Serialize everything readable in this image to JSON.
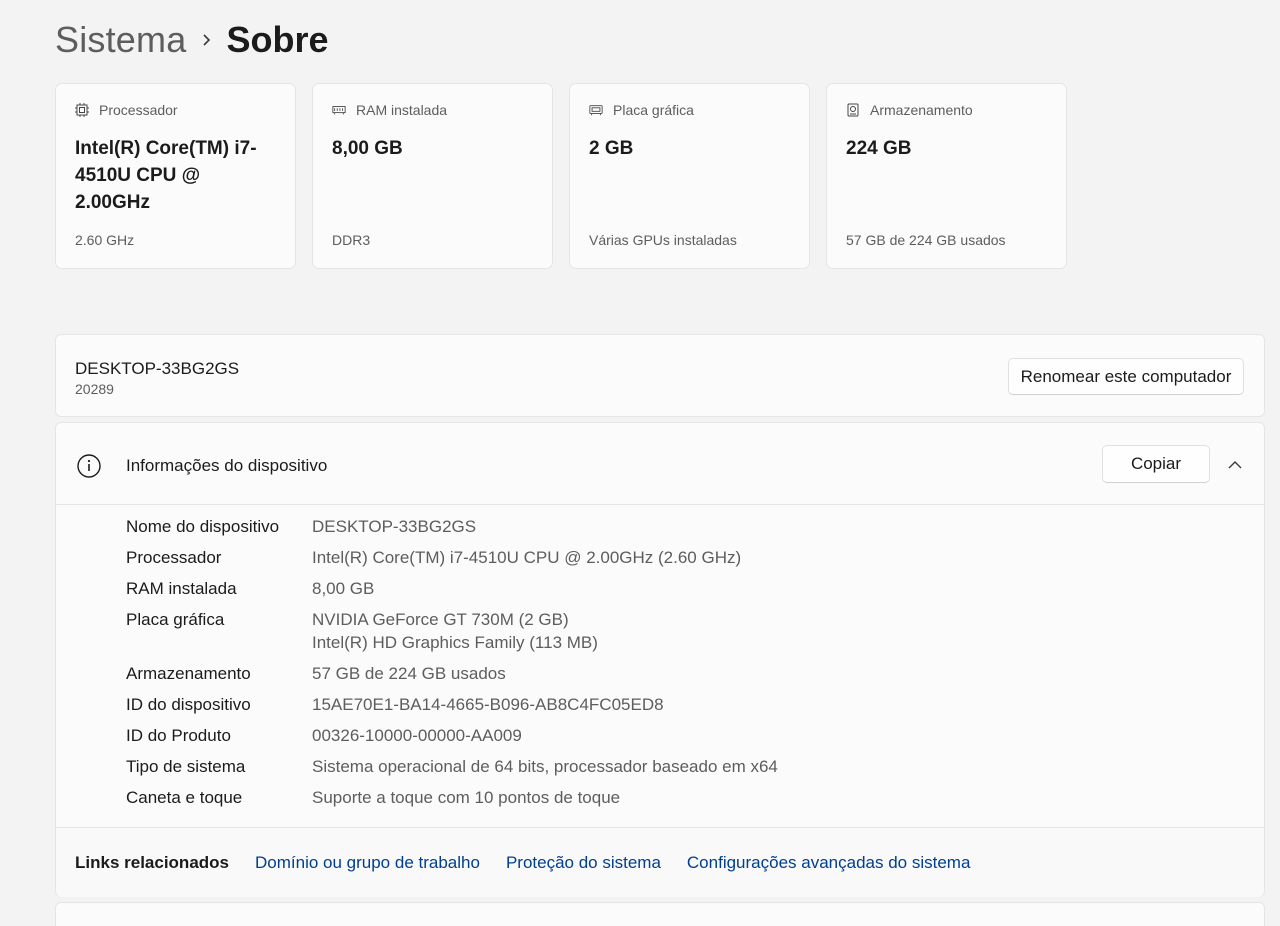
{
  "breadcrumb": {
    "parent": "Sistema",
    "current": "Sobre"
  },
  "cards": [
    {
      "label": "Processador",
      "value": "Intel(R) Core(TM) i7-4510U CPU @ 2.00GHz",
      "sub": "2.60 GHz",
      "icon": "processor-icon"
    },
    {
      "label": "RAM instalada",
      "value": "8,00 GB",
      "sub": "DDR3",
      "icon": "ram-icon"
    },
    {
      "label": "Placa gráfica",
      "value": "2 GB",
      "sub": "Várias GPUs instaladas",
      "icon": "gpu-icon"
    },
    {
      "label": "Armazenamento",
      "value": "224 GB",
      "sub": "57 GB de 224 GB usados",
      "icon": "storage-icon"
    }
  ],
  "device": {
    "name": "DESKTOP-33BG2GS",
    "number": "20289",
    "rename_label": "Renomear este computador"
  },
  "info": {
    "title": "Informações do dispositivo",
    "copy_label": "Copiar",
    "rows": [
      {
        "label": "Nome do dispositivo",
        "value": "DESKTOP-33BG2GS"
      },
      {
        "label": "Processador",
        "value": "Intel(R) Core(TM) i7-4510U CPU @ 2.00GHz (2.60 GHz)"
      },
      {
        "label": "RAM instalada",
        "value": "8,00 GB"
      },
      {
        "label": "Placa gráfica",
        "value": "NVIDIA GeForce GT 730M (2 GB)",
        "value2": "Intel(R) HD Graphics Family (113 MB)"
      },
      {
        "label": "Armazenamento",
        "value": "57 GB de 224 GB usados"
      },
      {
        "label": "ID do dispositivo",
        "value": "15AE70E1-BA14-4665-B096-AB8C4FC05ED8"
      },
      {
        "label": "ID do Produto",
        "value": "00326-10000-00000-AA009"
      },
      {
        "label": "Tipo de sistema",
        "value": "Sistema operacional de 64 bits, processador baseado em x64"
      },
      {
        "label": "Caneta e toque",
        "value": "Suporte a toque com 10 pontos de toque"
      }
    ]
  },
  "links": {
    "label": "Links relacionados",
    "items": [
      "Domínio ou grupo de trabalho",
      "Proteção do sistema",
      "Configurações avançadas do sistema"
    ]
  },
  "colors": {
    "link": "#003e92",
    "background": "#f3f3f3",
    "card": "#fbfbfb"
  }
}
